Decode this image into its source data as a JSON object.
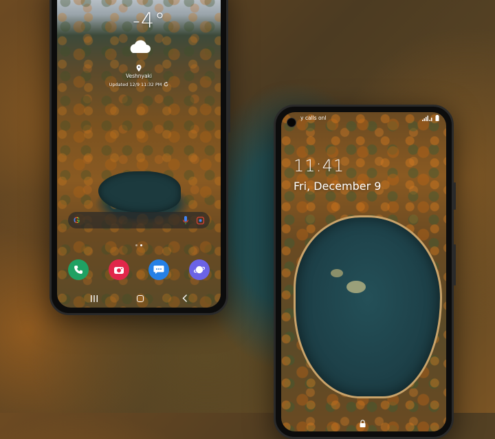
{
  "home_screen": {
    "weather": {
      "temperature": "-4°",
      "condition_icon": "cloud-icon",
      "location": "Veshnyaki",
      "updated": "Updated 12/9 11:32 PM"
    },
    "search_bar": {
      "logo": "G",
      "icons": [
        "mic-icon",
        "lens-icon"
      ]
    },
    "dock_apps": [
      {
        "name": "Phone",
        "icon": "phone-icon",
        "color": "#1fa163"
      },
      {
        "name": "Camera",
        "icon": "camera-icon",
        "color": "#e1274a"
      },
      {
        "name": "Messages",
        "icon": "messages-icon",
        "color": "#2580e6"
      },
      {
        "name": "Internet",
        "icon": "internet-icon",
        "color": "#6b63e6"
      }
    ],
    "page_indicator": {
      "count": 2,
      "active": 1
    },
    "nav_buttons": [
      "recents-icon",
      "home-icon",
      "back-icon"
    ]
  },
  "lock_screen": {
    "status": {
      "carrier_text": "y calls onl",
      "icons": [
        "signal-icon",
        "battery-icon"
      ]
    },
    "time": "11:41",
    "date": "Fri, December 9",
    "lock_icon": "lock-icon"
  }
}
